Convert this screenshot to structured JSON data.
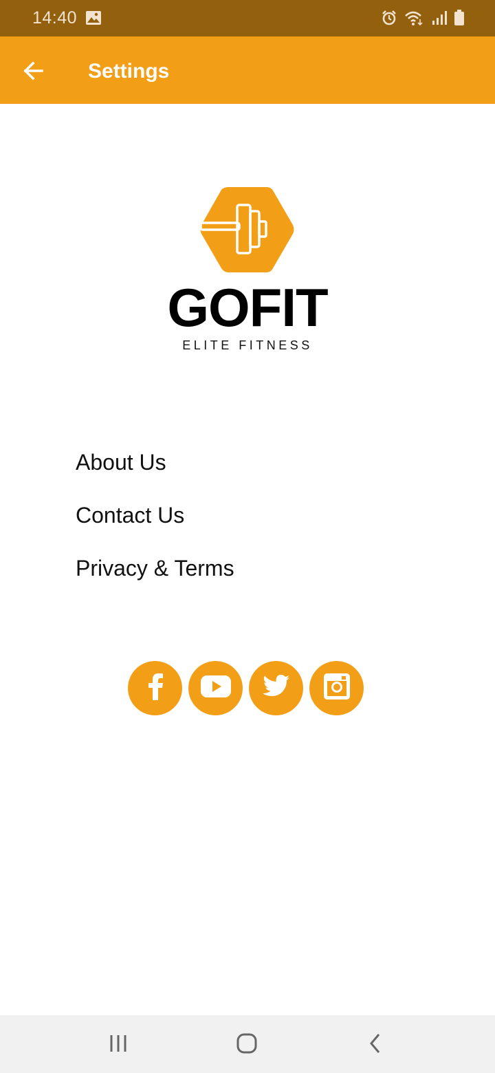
{
  "status_bar": {
    "time": "14:40",
    "icons": [
      "gallery-icon",
      "alarm-icon",
      "wifi-icon",
      "signal-icon",
      "battery-icon"
    ]
  },
  "app_bar": {
    "title": "Settings",
    "back_icon": "arrow-left-icon",
    "color": "#f39e17"
  },
  "logo": {
    "brand": "GOFIT",
    "tagline": "ELITE FITNESS",
    "icon": "dumbbell-hexagon-icon"
  },
  "menu": {
    "items": [
      {
        "label": "About Us"
      },
      {
        "label": "Contact Us"
      },
      {
        "label": "Privacy & Terms"
      }
    ]
  },
  "social": {
    "items": [
      {
        "icon": "facebook-icon"
      },
      {
        "icon": "youtube-icon"
      },
      {
        "icon": "twitter-icon"
      },
      {
        "icon": "instagram-icon"
      }
    ],
    "color": "#f39e17"
  },
  "nav_bar": {
    "buttons": [
      "recent-apps-icon",
      "home-icon",
      "back-icon"
    ]
  }
}
